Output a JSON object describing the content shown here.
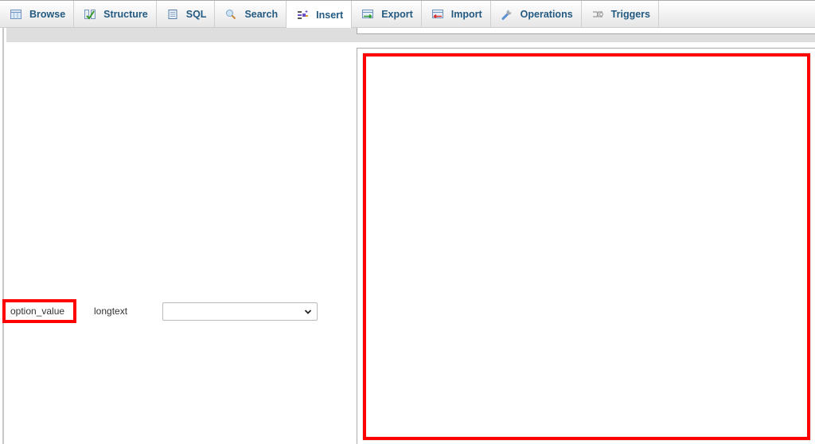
{
  "tabs": [
    {
      "label": "Browse",
      "icon": "browse-icon",
      "active": false
    },
    {
      "label": "Structure",
      "icon": "structure-icon",
      "active": false
    },
    {
      "label": "SQL",
      "icon": "sql-icon",
      "active": false
    },
    {
      "label": "Search",
      "icon": "search-icon",
      "active": false
    },
    {
      "label": "Insert",
      "icon": "insert-icon",
      "active": true
    },
    {
      "label": "Export",
      "icon": "export-icon",
      "active": false
    },
    {
      "label": "Import",
      "icon": "import-icon",
      "active": false
    },
    {
      "label": "Operations",
      "icon": "operations-icon",
      "active": false
    },
    {
      "label": "Triggers",
      "icon": "triggers-icon",
      "active": false
    }
  ],
  "insert_form": {
    "column_name": "option_value",
    "column_type": "longtext",
    "function_select": {
      "value": ""
    },
    "value_textarea": {
      "value": ""
    }
  },
  "colors": {
    "highlight": "#ff0000",
    "tab_text": "#235a81"
  }
}
